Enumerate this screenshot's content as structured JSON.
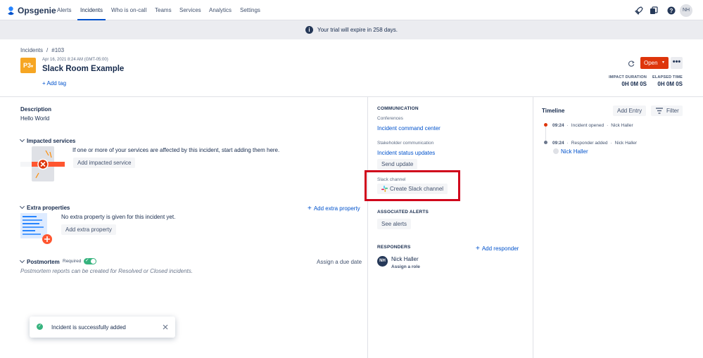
{
  "nav": {
    "app_name": "Opsgenie",
    "items": [
      "Alerts",
      "Incidents",
      "Who is on-call",
      "Teams",
      "Services",
      "Analytics",
      "Settings"
    ],
    "avatar_initials": "NH"
  },
  "banner": {
    "text": "Your trial will expire in 258 days."
  },
  "breadcrumb": {
    "parent": "Incidents",
    "separator": "/",
    "current": "#103"
  },
  "incident": {
    "priority": "P3",
    "date": "Apr 16, 2021 8:24 AM (GMT-05:00)",
    "title": "Slack Room Example",
    "add_tag": "+ Add tag",
    "status_button": "Open",
    "impact_label": "IMPACT DURATION",
    "impact_value": "0H 0M 0S",
    "elapsed_label": "ELAPSED TIME",
    "elapsed_value": "0H 0M 0S"
  },
  "description": {
    "title": "Description",
    "text": "Hello World"
  },
  "impacted": {
    "title": "Impacted services",
    "text": "If one or more of your services are affected by this incident, start adding them here.",
    "button": "Add impacted service"
  },
  "extra": {
    "title": "Extra properties",
    "add_link": "Add extra property",
    "text": "No extra property is given for this incident yet.",
    "button": "Add extra property"
  },
  "postmortem": {
    "title": "Postmortem",
    "required": "Required",
    "due_date": "Assign a due date",
    "note": "Postmortem reports can be created for Resolved or Closed incidents."
  },
  "toast": {
    "text": "Incident is successfully added"
  },
  "communication": {
    "title": "COMMUNICATION",
    "conferences_label": "Conferences",
    "conference_link": "Incident command center",
    "stakeholder_label": "Stakeholder communication",
    "stakeholder_link": "Incident status updates",
    "send_update": "Send update",
    "slack_label": "Slack channel",
    "slack_button": "Create Slack channel",
    "alerts_title": "ASSOCIATED ALERTS",
    "see_alerts": "See alerts",
    "responders_title": "RESPONDERS",
    "add_responder": "Add responder",
    "responder_initials": "NH",
    "responder_name": "Nick Haller",
    "assign_role": "Assign a role"
  },
  "timeline": {
    "title": "Timeline",
    "add_entry": "Add Entry",
    "filter": "Filter",
    "entries": [
      {
        "time": "09:24",
        "event": "Incident opened",
        "user": "Nick Haller"
      },
      {
        "time": "09:24",
        "event": "Responder added",
        "user": "Nick Haller"
      }
    ],
    "responder_link": "Nick Haller",
    "dot": "·"
  },
  "colors": {
    "accent": "#0052cc",
    "priority": "#f6a623",
    "open": "#de350b",
    "highlight": "#d0021b",
    "success": "#36b37e"
  }
}
